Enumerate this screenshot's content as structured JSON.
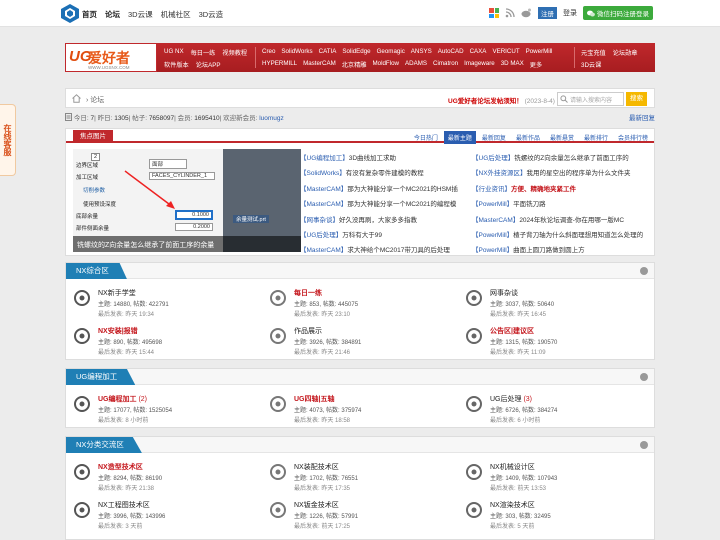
{
  "topbar": {
    "nav": [
      "首页",
      "论坛",
      "3D云课",
      "机械社区",
      "3D云造"
    ],
    "register": "注册",
    "login": "登录",
    "wechat": "微信扫码注册登录"
  },
  "side_tag": "在线客服",
  "brand": {
    "logo_text": "UG",
    "logo_name": "爱好者",
    "url": "WWW.UGSNX.COM"
  },
  "menu": {
    "row1_a": [
      "UG NX",
      "每日一练",
      "视频教程"
    ],
    "row2_a": [
      "软件版本",
      "论坛APP"
    ],
    "row1_b": [
      "Creo",
      "SolidWorks",
      "CATIA",
      "SolidEdge",
      "Geomagic",
      "ANSYS",
      "AutoCAD",
      "CAXA",
      "VERICUT",
      "PowerMill"
    ],
    "row2_b": [
      "HYPERMILL",
      "MasterCAM",
      "北京精雕",
      "MoldFlow",
      "ADAMS",
      "Cimatron",
      "Imageware",
      "3D MAX",
      "更多"
    ],
    "row1_c": [
      "元宝充值",
      "论坛勋章"
    ],
    "row2_c": [
      "3D云课"
    ]
  },
  "searchrow": {
    "crumb": "论坛",
    "notice": "UG爱好者论坛发帖须知！",
    "notice_date": "(2023-8-4)",
    "placeholder": "请输入搜索内容",
    "search_btn": "搜索"
  },
  "stats": {
    "today_label": "今日:",
    "today": "7",
    "yesterday_label": "昨日:",
    "yesterday": "1305",
    "posts_label": "帖子:",
    "posts": "7658097",
    "members_label": "会员:",
    "members": "1695410",
    "welcome": "欢迎新会员:",
    "new_member": "luomugz",
    "latest": "最新回复"
  },
  "focus": {
    "tab": "焦点图片",
    "nav": [
      "今日热门",
      "最新主题",
      "最新回复",
      "最新作品",
      "最新悬赏",
      "最新排行",
      "会员排行榜"
    ],
    "nav_active": 1,
    "caption": "铣螺纹的Z向余量怎么继承了前面工序的余量",
    "slide": {
      "field_label1": "边界区域",
      "field_label2": "加工区域",
      "field_val1": "面部",
      "field_val2": "FACES_CYLINDER_1",
      "section": "切削参数",
      "check": "使用预设深度",
      "depth_label": "底部余量",
      "depth_val": "0.1000",
      "side_label": "部件侧面余量",
      "side_val": "0.2000",
      "file": "余量测试.prt",
      "num": "2"
    },
    "left_list": [
      {
        "tag": "【UG编程加工】",
        "text": "3D曲线加工求助"
      },
      {
        "tag": "【SolidWorks】",
        "text": "有没有复杂零件建模的教程"
      },
      {
        "tag": "【MasterCAM】",
        "text": "那为大神能分享一个MC2021的HSM插"
      },
      {
        "tag": "【MasterCAM】",
        "text": "那为大神能分享一个MC2021的编程模"
      },
      {
        "tag": "【网事杂谈】",
        "text": "好久没再刷，大家多多指教"
      },
      {
        "tag": "【UG后处理】",
        "text": "万科有大于99"
      },
      {
        "tag": "【MasterCAM】",
        "text": "求大神给个MC2017带刀具的后处理"
      }
    ],
    "right_list": [
      {
        "tag": "【UG后处理】",
        "text": "铣螺纹的Z向余量怎么继承了前面工序的"
      },
      {
        "tag": "【NX外挂资源区】",
        "text": "我用的星空出的程序单为什么文件夹"
      },
      {
        "tag": "【行业资讯】",
        "text": "方便、精确地夹紧工件",
        "red": true
      },
      {
        "tag": "【PowerMill】",
        "text": "平面铣刀路"
      },
      {
        "tag": "【MasterCAM】",
        "text": "2024年秋论坛调查-你在用哪一版MC"
      },
      {
        "tag": "【PowerMill】",
        "text": "楂子背刀轴为什么斜面理想用知道怎么处理的"
      },
      {
        "tag": "【PowerMill】",
        "text": "曲面上圆刀路做到圆上方"
      }
    ]
  },
  "sections": [
    {
      "title": "NX综合区",
      "forums": [
        {
          "name": "NX新手学堂",
          "red": false,
          "count": "",
          "topics": "14880",
          "posts": "422791",
          "last": "最后发表: 昨天 19:34",
          "icon": "gear-icon"
        },
        {
          "name": "每日一练",
          "red": true,
          "count": "",
          "topics": "853",
          "posts": "445075",
          "last": "最后发表: 昨天 23:10",
          "icon": "rocket-icon"
        },
        {
          "name": "网事杂谈",
          "red": false,
          "count": "",
          "topics": "3037",
          "posts": "50640",
          "last": "最后发表: 昨天 16:45",
          "icon": "coffee-icon"
        },
        {
          "name": "NX安装|报错",
          "red": true,
          "count": "",
          "topics": "890",
          "posts": "495698",
          "last": "最后发表: 昨天 15:44",
          "icon": "wrench-icon"
        },
        {
          "name": "作品展示",
          "red": false,
          "count": "",
          "topics": "3926",
          "posts": "384891",
          "last": "最后发表: 昨天 21:46",
          "icon": "picture-icon"
        },
        {
          "name": "公告区|建议区",
          "red": true,
          "count": "",
          "topics": "1315",
          "posts": "190570",
          "last": "最后发表: 昨天 11:09",
          "icon": "gears-icon"
        }
      ]
    },
    {
      "title": "UG编程加工",
      "forums": [
        {
          "name": "UG编程加工",
          "red": true,
          "count": "(2)",
          "topics": "17077",
          "posts": "1525054",
          "last": "最后发表: 8 小时前",
          "icon": "drill-icon"
        },
        {
          "name": "UG四轴|五轴",
          "red": true,
          "count": "",
          "topics": "4073",
          "posts": "375974",
          "last": "最后发表: 昨天 18:58",
          "icon": "mill-icon"
        },
        {
          "name": "UG后处理",
          "red": false,
          "count": "(3)",
          "topics": "6726",
          "posts": "384274",
          "last": "最后发表: 6 小时前",
          "icon": "postprocess-icon"
        }
      ]
    },
    {
      "title": "NX分类交流区",
      "forums": [
        {
          "name": "NX造型技术区",
          "red": true,
          "count": "",
          "topics": "8294",
          "posts": "86190",
          "last": "最后发表: 昨天 21:38",
          "icon": "shape-icon"
        },
        {
          "name": "NX装配技术区",
          "red": false,
          "count": "",
          "topics": "1702",
          "posts": "76551",
          "last": "最后发表: 昨天 17:35",
          "icon": "assembly-icon"
        },
        {
          "name": "NX机械设计区",
          "red": false,
          "count": "",
          "topics": "1409",
          "posts": "107943",
          "last": "最后发表: 前天 13:53",
          "icon": "robot-icon"
        },
        {
          "name": "NX工程图技术区",
          "red": false,
          "count": "",
          "topics": "3996",
          "posts": "143996",
          "last": "最后发表: 3 天前",
          "icon": "drawing-icon"
        },
        {
          "name": "NX钣金技术区",
          "red": false,
          "count": "",
          "topics": "1226",
          "posts": "57991",
          "last": "最后发表: 前天 17:25",
          "icon": "sheetmetal-icon"
        },
        {
          "name": "NX渲染技术区",
          "red": false,
          "count": "",
          "topics": "303",
          "posts": "32495",
          "last": "最后发表: 5 天前",
          "icon": "render-icon"
        }
      ]
    }
  ],
  "labels": {
    "topics": "主题: ",
    "posts": ", 帖数: "
  }
}
